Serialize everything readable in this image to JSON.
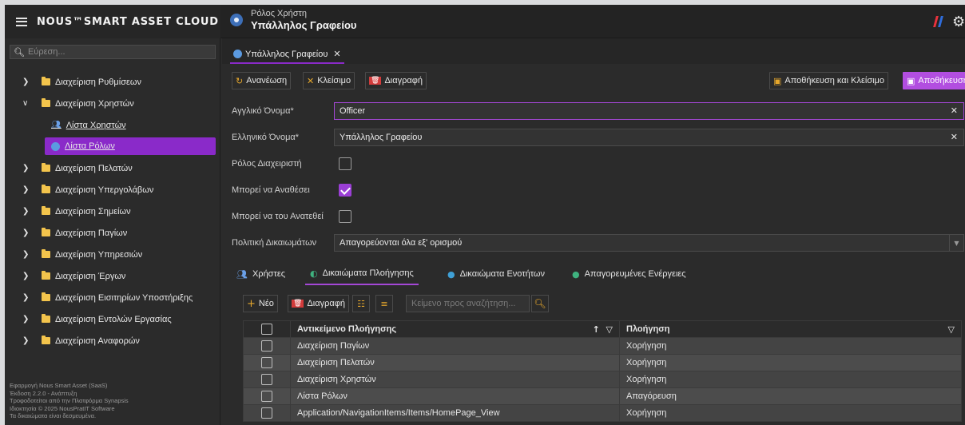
{
  "app": {
    "brand": "NOUS™SMART ASSET CLOUD",
    "header_role_caption": "Ρόλος Χρήστη",
    "header_role_name": "Υπάλληλος Γραφείου",
    "logo_colors": [
      "#e8323c",
      "#2f6ddc"
    ]
  },
  "sidebar": {
    "search_placeholder": "Εύρεση...",
    "items": [
      {
        "label": "Διαχείριση Ρυθμίσεων",
        "expanded": false
      },
      {
        "label": "Διαχείριση Χρηστών",
        "expanded": true
      },
      {
        "label": "Διαχείριση Πελατών",
        "expanded": false
      },
      {
        "label": "Διαχείριση Υπεργολάβων",
        "expanded": false
      },
      {
        "label": "Διαχείριση Σημείων",
        "expanded": false
      },
      {
        "label": "Διαχείριση Παγίων",
        "expanded": false
      },
      {
        "label": "Διαχείριση Υπηρεσιών",
        "expanded": false
      },
      {
        "label": "Διαχείριση Έργων",
        "expanded": false
      },
      {
        "label": "Διαχείριση Εισιτηρίων Υποστήριξης",
        "expanded": false
      },
      {
        "label": "Διαχείριση Εντολών Εργασίας",
        "expanded": false
      },
      {
        "label": "Διαχείριση Αναφορών",
        "expanded": false
      }
    ],
    "subitems": [
      {
        "label": "Λίστα Χρηστών",
        "icon": "users-icon"
      },
      {
        "label": "Λίστα Ρόλων",
        "icon": "role-icon",
        "active": true
      }
    ],
    "footer": [
      "Εφαρμογή Nous Smart Asset (SaaS)",
      "Έκδοση 2.2.0 - Ανάπτυξη",
      "Τροφοδοτείται από την Πλατφόρμα Synapsis",
      "Ιδιοκτησία © 2025 NousPratIT Software",
      "Τα δικαιώματα είναι δεσμευμένα."
    ]
  },
  "tabs": [
    {
      "label": "Υπάλληλος Γραφείου"
    }
  ],
  "toolbar": {
    "refresh": "Ανανέωση",
    "close": "Κλείσιμο",
    "delete": "Διαγραφή",
    "save_close": "Αποθήκευση και Κλείσιμο",
    "save": "Αποθήκευση"
  },
  "form": {
    "english_name_label": "Αγγλικό Όνομα*",
    "english_name_value": "Officer",
    "greek_name_label": "Ελληνικό Όνομα*",
    "greek_name_value": "Υπάλληλος Γραφείου",
    "admin_role_label": "Ρόλος Διαχειριστή",
    "admin_role_checked": false,
    "can_assign_label": "Μπορεί να Αναθέσει",
    "can_assign_checked": true,
    "can_be_assigned_label": "Μπορεί να του Ανατεθεί",
    "can_be_assigned_checked": false,
    "policy_label": "Πολιτική Δικαιωμάτων",
    "policy_value": "Απαγορεύονται όλα εξ' ορισμού"
  },
  "detail_tabs": [
    {
      "label": "Χρήστες",
      "icon": "users-icon"
    },
    {
      "label": "Δικαιώματα Πλοήγησης",
      "icon": "navigation-rights-icon",
      "active": true
    },
    {
      "label": "Δικαιώματα Ενοτήτων",
      "icon": "module-rights-icon"
    },
    {
      "label": "Απαγορευμένες Ενέργειες",
      "icon": "forbidden-actions-icon"
    }
  ],
  "grid_toolbar": {
    "new": "Νέο",
    "delete": "Διαγραφή",
    "search_placeholder": "Κείμενο προς αναζήτηση..."
  },
  "grid": {
    "columns": [
      "Αντικείμενο Πλοήγησης",
      "Πλοήγηση"
    ],
    "rows": [
      [
        "Διαχείριση Παγίων",
        "Χορήγηση"
      ],
      [
        "Διαχείριση Πελατών",
        "Χορήγηση"
      ],
      [
        "Διαχείριση Χρηστών",
        "Χορήγηση"
      ],
      [
        "Λίστα Ρόλων",
        "Απαγόρευση"
      ],
      [
        "Application/NavigationItems/Items/HomePage_View",
        "Χορήγηση"
      ]
    ]
  },
  "colors": {
    "accent": "#8a2ac9",
    "folder": "#f3c44c",
    "background": "#2b2b2b"
  }
}
